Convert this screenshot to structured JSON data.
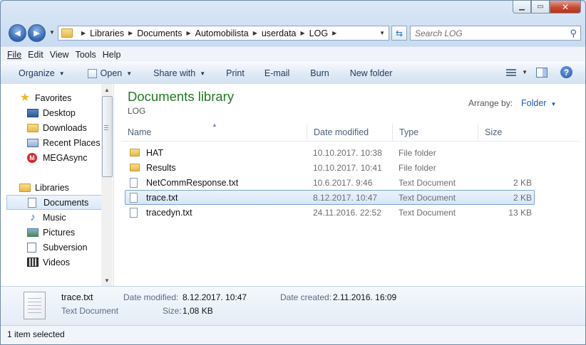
{
  "window": {
    "min_label": "▁",
    "max_label": "▭",
    "close_label": "✕"
  },
  "nav": {
    "back_glyph": "◀",
    "forward_glyph": "▶"
  },
  "address": {
    "crumbs": [
      "Libraries",
      "Documents",
      "Automobilista",
      "userdata",
      "LOG"
    ]
  },
  "search": {
    "placeholder": "Search LOG"
  },
  "menu": [
    "File",
    "Edit",
    "View",
    "Tools",
    "Help"
  ],
  "toolbar": {
    "organize": "Organize",
    "open": "Open",
    "share_with": "Share with",
    "print": "Print",
    "email": "E-mail",
    "burn": "Burn",
    "new_folder": "New folder",
    "help": "?"
  },
  "sidebar": {
    "favorites": "Favorites",
    "favorite_items": [
      "Desktop",
      "Downloads",
      "Recent Places",
      "MEGAsync"
    ],
    "libraries": "Libraries",
    "library_items": [
      "Documents",
      "Music",
      "Pictures",
      "Subversion",
      "Videos"
    ],
    "selected": "Documents"
  },
  "library": {
    "title": "Documents library",
    "subtitle": "LOG",
    "arrange_label": "Arrange by:",
    "arrange_value": "Folder"
  },
  "columns": [
    "Name",
    "Date modified",
    "Type",
    "Size"
  ],
  "files": [
    {
      "name": "HAT",
      "date": "10.10.2017. 10:38",
      "type": "File folder",
      "size": "",
      "kind": "folder"
    },
    {
      "name": "Results",
      "date": "10.10.2017. 10:41",
      "type": "File folder",
      "size": "",
      "kind": "folder"
    },
    {
      "name": "NetCommResponse.txt",
      "date": "10.6.2017. 9:46",
      "type": "Text Document",
      "size": "2 KB",
      "kind": "txt"
    },
    {
      "name": "trace.txt",
      "date": "8.12.2017. 10:47",
      "type": "Text Document",
      "size": "2 KB",
      "kind": "txt",
      "selected": true
    },
    {
      "name": "tracedyn.txt",
      "date": "24.11.2016. 22:52",
      "type": "Text Document",
      "size": "13 KB",
      "kind": "txt"
    }
  ],
  "details": {
    "file_name": "trace.txt",
    "file_type": "Text Document",
    "modified_label": "Date modified:",
    "modified_value": "8.12.2017. 10:47",
    "created_label": "Date created:",
    "created_value": "2.11.2016. 16:09",
    "size_label": "Size:",
    "size_value": "1,08 KB"
  },
  "status": {
    "text": "1 item selected"
  }
}
